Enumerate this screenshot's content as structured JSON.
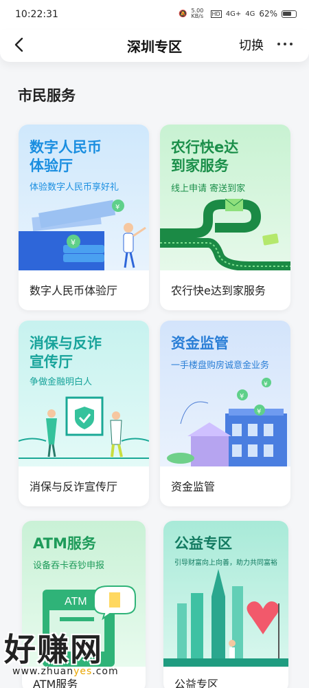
{
  "status_bar": {
    "time": "10:22:31",
    "net_speed": "5.00 KB/s",
    "hd": "HD",
    "signal1": "4G+",
    "signal2": "4G",
    "battery": "62%"
  },
  "nav": {
    "title": "深圳专区",
    "switch_label": "切换",
    "more_label": "···",
    "back_label": "‹"
  },
  "section": {
    "title": "市民服务"
  },
  "cards": [
    {
      "headline_1": "数字人民币",
      "headline_2": "体验厅",
      "subtitle": "体验数字人民币享好礼",
      "label": "数字人民币体验厅"
    },
    {
      "headline_1": "农行快e达",
      "headline_2": "到家服务",
      "subtitle": "线上申请 寄送到家",
      "label": "农行快e达到家服务"
    },
    {
      "headline_1": "消保与反诈",
      "headline_2": "宣传厅",
      "subtitle": "争做金融明白人",
      "label": "消保与反诈宣传厅"
    },
    {
      "headline_1": "资金监管",
      "headline_2": "",
      "subtitle": "一手楼盘购房诚意金业务",
      "label": "资金监管"
    },
    {
      "headline_1": "ATM服务",
      "headline_2": "",
      "subtitle": "设备吞卡吞钞申报",
      "label": "ATM服务",
      "art_text": "ATM"
    },
    {
      "headline_1": "公益专区",
      "headline_2": "",
      "subtitle": "引导财富向上向善，助力共同富裕",
      "label": "公益专区"
    }
  ],
  "watermark": {
    "big": "好赚网",
    "small_pre": "www.zhuan",
    "small_hl": "yes",
    "small_post": ".com"
  },
  "colors": {
    "blue_head": "#1a8ee0",
    "green_head": "#1b8f4a",
    "teal_head": "#17a39a",
    "accent_yellow": "#e8a500"
  }
}
